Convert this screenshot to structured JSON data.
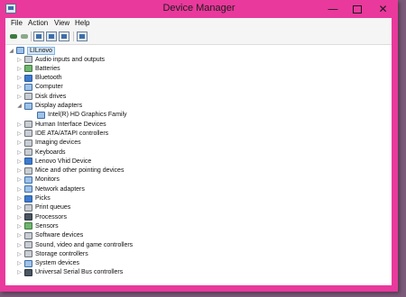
{
  "window": {
    "title": "Device Manager"
  },
  "title_buttons": {
    "minimize": "—",
    "close": "✕"
  },
  "menubar": [
    "File",
    "Action",
    "View",
    "Help"
  ],
  "tree": {
    "root": "LILnovo",
    "items": [
      {
        "label": "Audio inputs and outputs",
        "icon": "speaker-icon",
        "expander": "▷"
      },
      {
        "label": "Batteries",
        "icon": "battery-icon",
        "expander": "▷"
      },
      {
        "label": "Bluetooth",
        "icon": "bluetooth-icon",
        "expander": "▷"
      },
      {
        "label": "Computer",
        "icon": "computer-icon",
        "expander": "▷"
      },
      {
        "label": "Disk drives",
        "icon": "disk-icon",
        "expander": "▷"
      },
      {
        "label": "Display adapters",
        "icon": "display-adapter-icon",
        "expander": "◢"
      },
      {
        "label": "Intel(R) HD Graphics Family",
        "icon": "display-adapter-icon",
        "expander": "",
        "child": true
      },
      {
        "label": "Human Interface Devices",
        "icon": "hid-icon",
        "expander": "▷"
      },
      {
        "label": "IDE ATA/ATAPI controllers",
        "icon": "controller-icon",
        "expander": "▷"
      },
      {
        "label": "Imaging devices",
        "icon": "camera-icon",
        "expander": "▷"
      },
      {
        "label": "Keyboards",
        "icon": "keyboard-icon",
        "expander": "▷"
      },
      {
        "label": "Lenovo Vhid Device",
        "icon": "device-icon",
        "expander": "▷"
      },
      {
        "label": "Mice and other pointing devices",
        "icon": "mouse-icon",
        "expander": "▷"
      },
      {
        "label": "Monitors",
        "icon": "monitor-icon",
        "expander": "▷"
      },
      {
        "label": "Network adapters",
        "icon": "network-icon",
        "expander": "▷"
      },
      {
        "label": "Picks",
        "icon": "device-icon",
        "expander": "▷"
      },
      {
        "label": "Print queues",
        "icon": "printer-icon",
        "expander": "▷"
      },
      {
        "label": "Processors",
        "icon": "processor-icon",
        "expander": "▷"
      },
      {
        "label": "Sensors",
        "icon": "sensor-icon",
        "expander": "▷"
      },
      {
        "label": "Software devices",
        "icon": "software-icon",
        "expander": "▷"
      },
      {
        "label": "Sound, video and game controllers",
        "icon": "speaker-icon",
        "expander": "▷"
      },
      {
        "label": "Storage controllers",
        "icon": "storage-icon",
        "expander": "▷"
      },
      {
        "label": "System devices",
        "icon": "system-icon",
        "expander": "▷"
      },
      {
        "label": "Universal Serial Bus controllers",
        "icon": "usb-icon",
        "expander": "▷"
      }
    ]
  },
  "colors": {
    "titlebar": "#e9399c",
    "selection": "#d6e8f9"
  }
}
